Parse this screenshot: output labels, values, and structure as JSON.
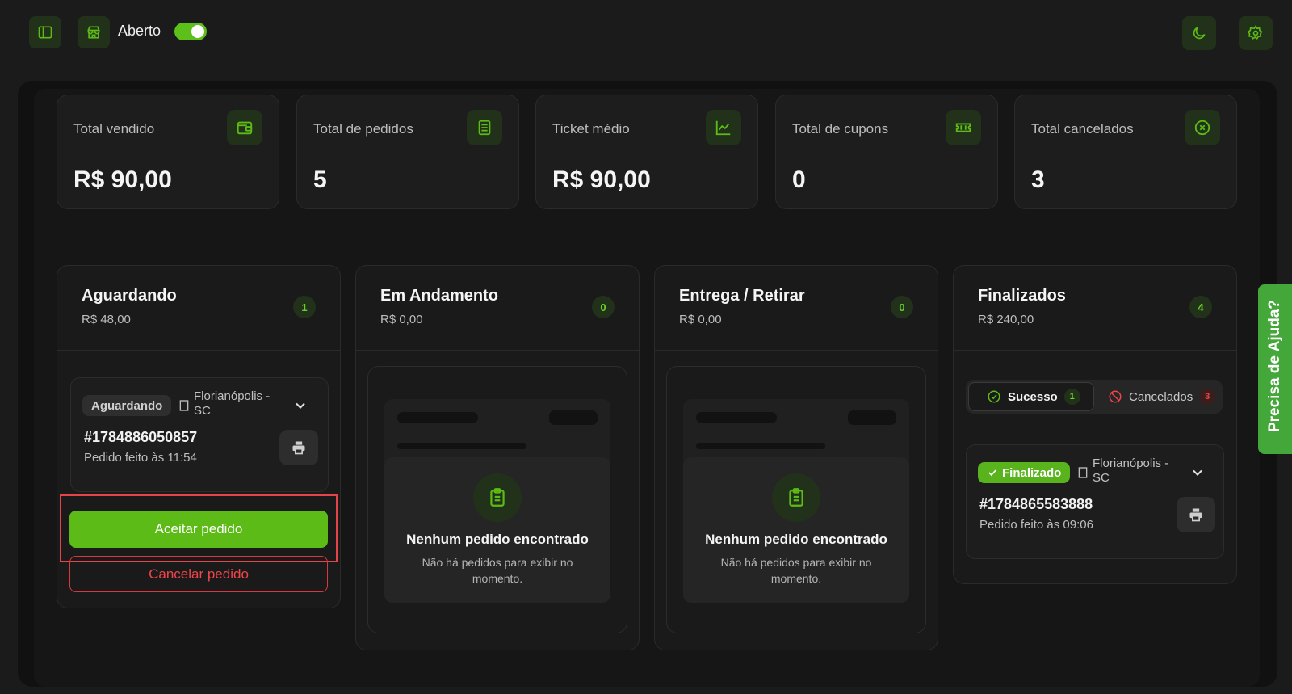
{
  "topbar": {
    "store_status_label": "Aberto",
    "store_open": true
  },
  "stats": [
    {
      "label": "Total vendido",
      "value": "R$ 90,00",
      "icon": "wallet-icon"
    },
    {
      "label": "Total de pedidos",
      "value": "5",
      "icon": "receipt-icon"
    },
    {
      "label": "Ticket médio",
      "value": "R$ 90,00",
      "icon": "chart-line-icon"
    },
    {
      "label": "Total de cupons",
      "value": "0",
      "icon": "ticket-icon"
    },
    {
      "label": "Total cancelados",
      "value": "3",
      "icon": "x-circle-icon"
    }
  ],
  "columns": {
    "aguardando": {
      "title": "Aguardando",
      "total": "R$ 48,00",
      "count": "1",
      "order": {
        "status": "Aguardando",
        "location": "Florianópolis - SC",
        "id": "#1784886050857",
        "time": "Pedido feito às 11:54"
      },
      "accept_label": "Aceitar pedido",
      "cancel_label": "Cancelar pedido"
    },
    "andamento": {
      "title": "Em Andamento",
      "total": "R$ 0,00",
      "count": "0",
      "empty_title": "Nenhum pedido encontrado",
      "empty_text": "Não há pedidos para exibir no momento."
    },
    "entrega": {
      "title": "Entrega / Retirar",
      "total": "R$ 0,00",
      "count": "0",
      "empty_title": "Nenhum pedido encontrado",
      "empty_text": "Não há pedidos para exibir no momento."
    },
    "finalizados": {
      "title": "Finalizados",
      "total": "R$ 240,00",
      "count": "4",
      "tabs": {
        "success_label": "Sucesso",
        "success_count": "1",
        "cancel_label": "Cancelados",
        "cancel_count": "3"
      },
      "order": {
        "status": "Finalizado",
        "location": "Florianópolis - SC",
        "id": "#1784865583888",
        "time": "Pedido feito às 09:06"
      }
    }
  },
  "help": {
    "label": "Precisa de Ajuda?"
  },
  "colors": {
    "accent": "#5cbb16",
    "danger": "#ef4449",
    "background": "#1b1b1b"
  }
}
